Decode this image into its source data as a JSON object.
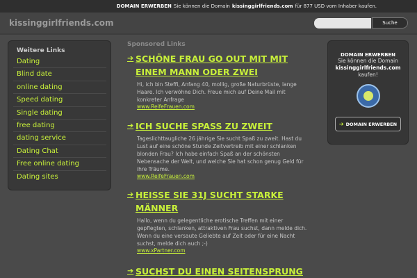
{
  "topbar": {
    "label": "DOMAIN ERWERBEN",
    "text_before": "Sie können die Domain",
    "domain": "kissinggirlfriends.com",
    "text_after": "für 877 USD vom Inhaber kaufen."
  },
  "header": {
    "site_name": "kissinggirlfriends.com",
    "search_placeholder": "",
    "search_button": "Suche"
  },
  "left": {
    "title": "Weitere Links",
    "items": [
      "Dating",
      "Blind date",
      "online dating",
      "Speed dating",
      "Single dating",
      "free dating",
      "dating service",
      "Dating Chat",
      "Free online dating",
      "Dating sites"
    ]
  },
  "center": {
    "sponsored_label": "Sponsored Links",
    "ads": [
      {
        "title_line1": "SCHÖNE FRAU GO OUT MIT MIT",
        "title_line2": "EINEM MANN ODER ZWEI",
        "desc": "Hi, ich bin Steffi, Anfang 40, mollig, große  Naturbrüste, lange Haare. Ich verwöhne Dich. Freue mich auf Deine Mail mit konkreter Anfrage",
        "url": "www.ReifeFrauen.com"
      },
      {
        "title_line1": "ICH SUCHE SPASS ZU ZWEIT",
        "title_line2": "",
        "desc": "Tageslichttaugliche 26 jährige Sie sucht Spaß zu zweit. Hast du Lust auf eine schöne Stunde Zeitvertreib mit einer schlanken blonden Frau? Ich habe einfach Spaß an der schönsten Nebensache der Welt, und welche Sie hat schon genug Geld für ihre Träume.",
        "url": "www.ReifeFrauen.com"
      },
      {
        "title_line1": "HEISSE SIE 31J SUCHT STARKE",
        "title_line2": "MÄNNER",
        "desc": "Hallo, wenn du gelegentliche erotische Treffen mit einer gepflegten, schlanken, attraktiven Frau suchst, dann melde dich. Wenn du eine versaute Geliebte auf Zeit oder für eine Nacht suchst, melde dich auch ;-)",
        "url": "www.xPartner.com"
      },
      {
        "title_line1": "SUCHST DU EINEN SEITENSPRUNG",
        "title_line2": "",
        "desc": "",
        "url": ""
      }
    ]
  },
  "right": {
    "title": "DOMAIN ERWERBEN",
    "line1": "Sie können die Domain",
    "domain": "kissinggirlfriends.com",
    "line2": "kaufen!",
    "button": "DOMAIN ERWERBEN",
    "colors": {
      "accent": "#c8f03a"
    }
  }
}
